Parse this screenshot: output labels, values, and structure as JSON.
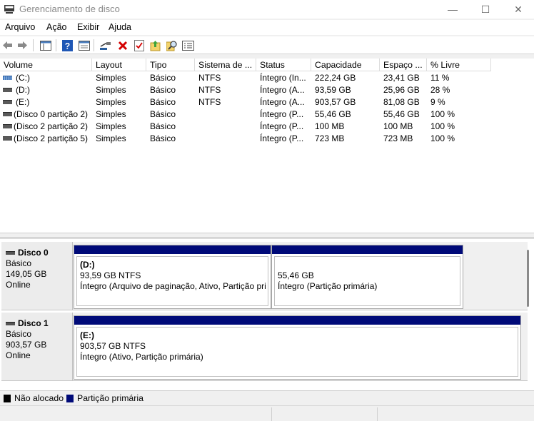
{
  "window": {
    "title": "Gerenciamento de disco",
    "minimize_glyph": "—",
    "maximize_glyph": "☐",
    "close_glyph": "✕"
  },
  "menu": [
    "Arquivo",
    "Ação",
    "Exibir",
    "Ajuda"
  ],
  "toolbar_icons": [
    "back-arrow-icon",
    "forward-arrow-icon",
    "console-tree-icon",
    "help-icon",
    "properties-view-icon",
    "connect-icon",
    "delete-icon",
    "checklist-icon",
    "import-icon",
    "search-icon",
    "details-icon"
  ],
  "columns": [
    "Volume",
    "Layout",
    "Tipo",
    "Sistema de ...",
    "Status",
    "Capacidade",
    "Espaço ...",
    "% Livre"
  ],
  "volumes": [
    {
      "volume": "(C:)",
      "layout": "Simples",
      "tipo": "Básico",
      "sistema": "NTFS",
      "status": "Íntegro (In...",
      "capacidade": "222,24 GB",
      "espaco": "23,41 GB",
      "livre": "11 %"
    },
    {
      "volume": "(D:)",
      "layout": "Simples",
      "tipo": "Básico",
      "sistema": "NTFS",
      "status": "Íntegro (A...",
      "capacidade": "93,59 GB",
      "espaco": "25,96 GB",
      "livre": "28 %"
    },
    {
      "volume": "(E:)",
      "layout": "Simples",
      "tipo": "Básico",
      "sistema": "NTFS",
      "status": "Íntegro (A...",
      "capacidade": "903,57 GB",
      "espaco": "81,08 GB",
      "livre": "9 %"
    },
    {
      "volume": "(Disco 0 partição 2)",
      "layout": "Simples",
      "tipo": "Básico",
      "sistema": "",
      "status": "Íntegro (P...",
      "capacidade": "55,46 GB",
      "espaco": "55,46 GB",
      "livre": "100 %"
    },
    {
      "volume": "(Disco 2 partição 2)",
      "layout": "Simples",
      "tipo": "Básico",
      "sistema": "",
      "status": "Íntegro (P...",
      "capacidade": "100 MB",
      "espaco": "100 MB",
      "livre": "100 %"
    },
    {
      "volume": "(Disco 2 partição 5)",
      "layout": "Simples",
      "tipo": "Básico",
      "sistema": "",
      "status": "Íntegro (P...",
      "capacidade": "723 MB",
      "espaco": "723 MB",
      "livre": "100 %"
    }
  ],
  "disks": [
    {
      "name": "Disco 0",
      "type": "Básico",
      "size": "149,05 GB",
      "state": "Online",
      "partitions": [
        {
          "label": "(D:)",
          "size": "93,59 GB NTFS",
          "status": "Íntegro (Arquivo de paginação, Ativo, Partição pri"
        },
        {
          "label": "",
          "size": "55,46 GB",
          "status": "Íntegro (Partição primária)"
        }
      ]
    },
    {
      "name": "Disco 1",
      "type": "Básico",
      "size": "903,57 GB",
      "state": "Online",
      "partitions": [
        {
          "label": "(E:)",
          "size": "903,57 GB NTFS",
          "status": "Íntegro (Ativo, Partição primária)"
        }
      ]
    }
  ],
  "legend": [
    {
      "label": "Não alocado",
      "color": "#000000"
    },
    {
      "label": "Partição primária",
      "color": "#000a78"
    }
  ]
}
